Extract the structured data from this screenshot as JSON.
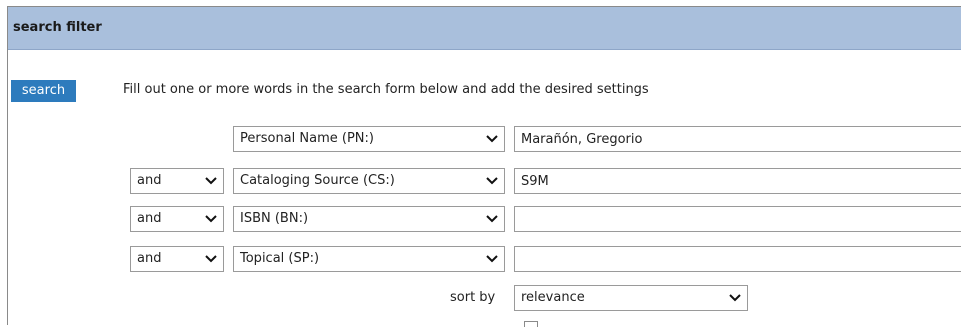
{
  "header": {
    "title": "search filter"
  },
  "search_button": {
    "label": "search"
  },
  "instructions": "Fill out one or more words in the search form below and add the desired settings",
  "rows": [
    {
      "operator": null,
      "field": "Personal Name (PN:)",
      "value": "Marañón, Gregorio"
    },
    {
      "operator": "and",
      "field": "Cataloging Source (CS:)",
      "value": "S9M"
    },
    {
      "operator": "and",
      "field": "ISBN (BN:)",
      "value": ""
    },
    {
      "operator": "and",
      "field": "Topical (SP:)",
      "value": ""
    }
  ],
  "sort": {
    "label": "sort by",
    "value": "relevance"
  },
  "icons": {
    "dropdown": "chevron-down-icon"
  },
  "colors": {
    "header_bg": "#a9bfdc",
    "search_button_bg": "#2d7bbd"
  }
}
